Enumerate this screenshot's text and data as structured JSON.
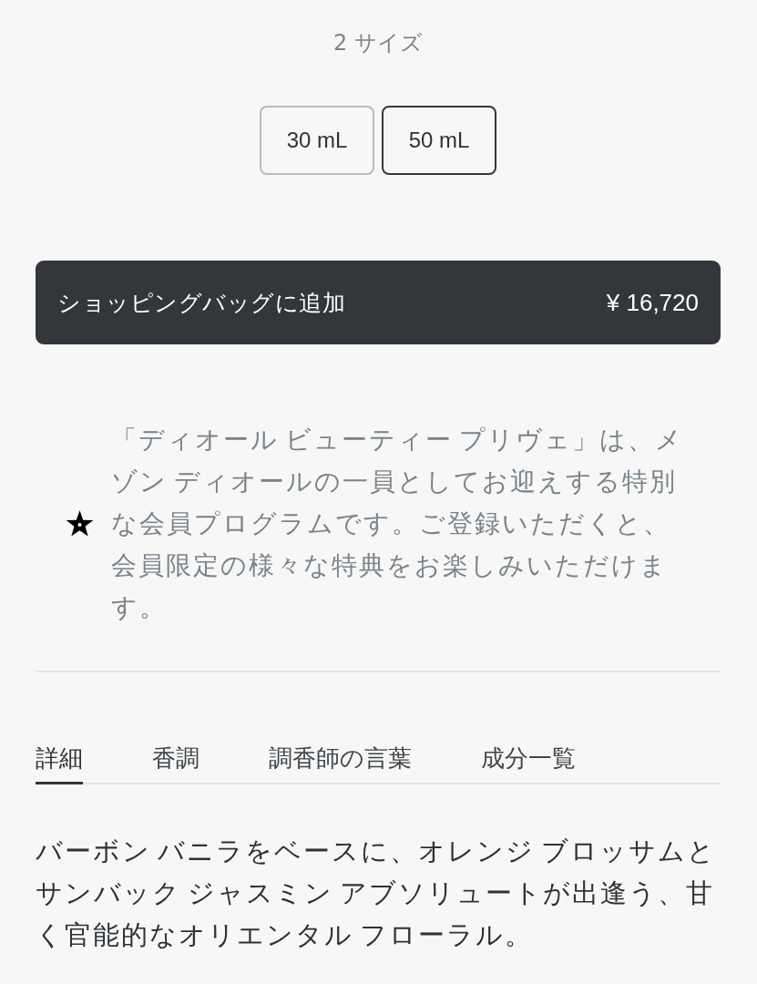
{
  "sizes": {
    "count_label": "2 サイズ",
    "options": [
      {
        "label": "30 mL",
        "selected": false
      },
      {
        "label": "50 mL",
        "selected": true
      }
    ]
  },
  "add_to_bag": {
    "label": "ショッピングバッグに追加",
    "price": "¥ 16,720"
  },
  "membership": {
    "text": "「ディオール ビューティー プリヴェ」は、メゾン ディオールの一員としてお迎えする特別な会員プログラムです。ご登録いただくと、会員限定の様々な特典をお楽しみいただけます。"
  },
  "tabs": [
    {
      "label": "詳細",
      "selected": true
    },
    {
      "label": "香調",
      "selected": false
    },
    {
      "label": "調香師の言葉",
      "selected": false
    },
    {
      "label": "成分一覧",
      "selected": false
    }
  ],
  "description": "バーボン バニラをベースに、オレンジ ブロッサムとサンバック ジャスミン アブソリュートが出逢う、甘く官能的なオリエンタル フローラル。"
}
